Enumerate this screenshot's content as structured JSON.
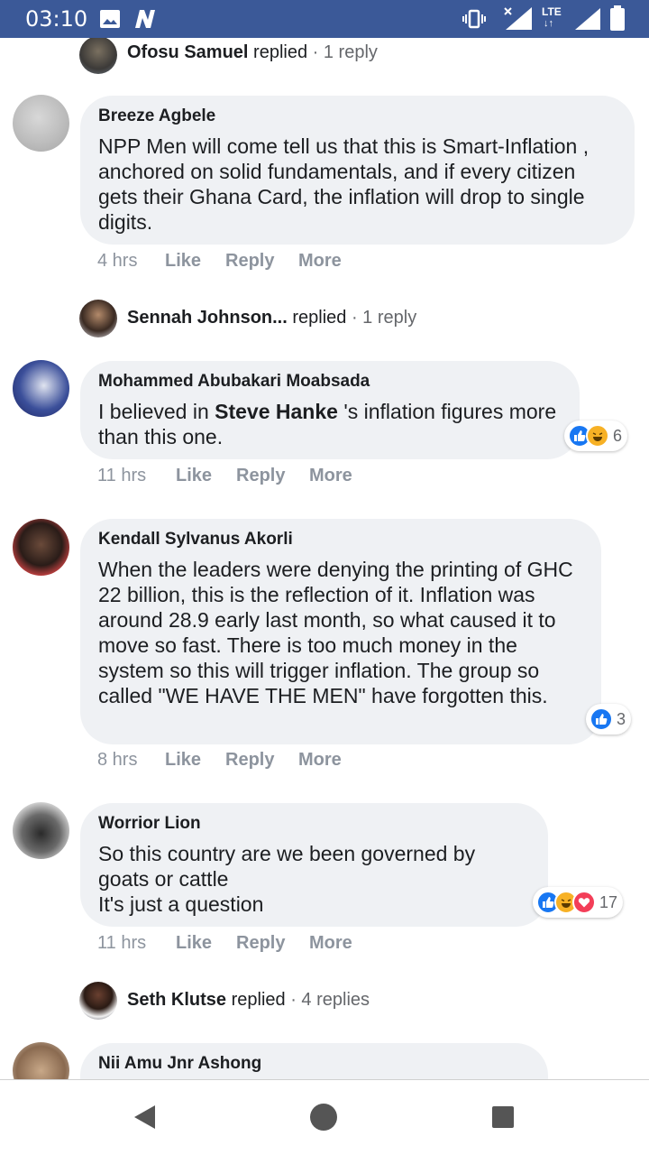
{
  "status_bar": {
    "time": "03:10",
    "network": "LTE"
  },
  "comments": [
    {
      "author": "Breeze Agbele",
      "text": "NPP Men will come tell us that this is Smart-Inflation , anchored on solid fundamentals, and if every citizen gets their Ghana Card, the inflation will drop to single digits.",
      "time": "4 hrs"
    },
    {
      "author": "Mohammed Abubakari Moabsada",
      "text_before": "I believed in ",
      "text_bold": "Steve Hanke",
      "text_after": " 's inflation figures more than this one.",
      "time": "11 hrs",
      "reaction_count": "6"
    },
    {
      "author": "Kendall Sylvanus Akorli",
      "text": "When the leaders were denying the printing of GHC 22 billion, this is the reflection of it. Inflation was around 28.9 early last month, so what caused it to move so fast. There is too much money in the system so this will trigger inflation. The group so called \"WE HAVE THE MEN\" have forgotten this.",
      "time": "8 hrs",
      "reaction_count": "3"
    },
    {
      "author": "Worrior Lion",
      "line1": "So this country are we been governed by goats or cattle",
      "line2": "It's just a question",
      "time": "11 hrs",
      "reaction_count": "17"
    },
    {
      "author": "Nii Amu Jnr Ashong"
    }
  ],
  "replies": [
    {
      "name": "Ofosu Samuel",
      "verb": " replied",
      "count": " · 1 reply"
    },
    {
      "name": "Sennah Johnson...",
      "verb": " replied",
      "count": " · 1 reply"
    },
    {
      "name": "Seth Klutse",
      "verb": " replied",
      "count": " · 4 replies"
    }
  ],
  "actions": {
    "like": "Like",
    "reply": "Reply",
    "more": "More"
  },
  "icons": {
    "reactions": [
      "like-icon",
      "haha-icon",
      "love-icon"
    ],
    "nav": [
      "back-icon",
      "home-icon",
      "recents-icon"
    ]
  },
  "colors": {
    "status_bar": "#3b5998",
    "bubble": "#eff1f4",
    "like": "#1877f2",
    "haha": "#f7b125",
    "love": "#f33e58"
  }
}
